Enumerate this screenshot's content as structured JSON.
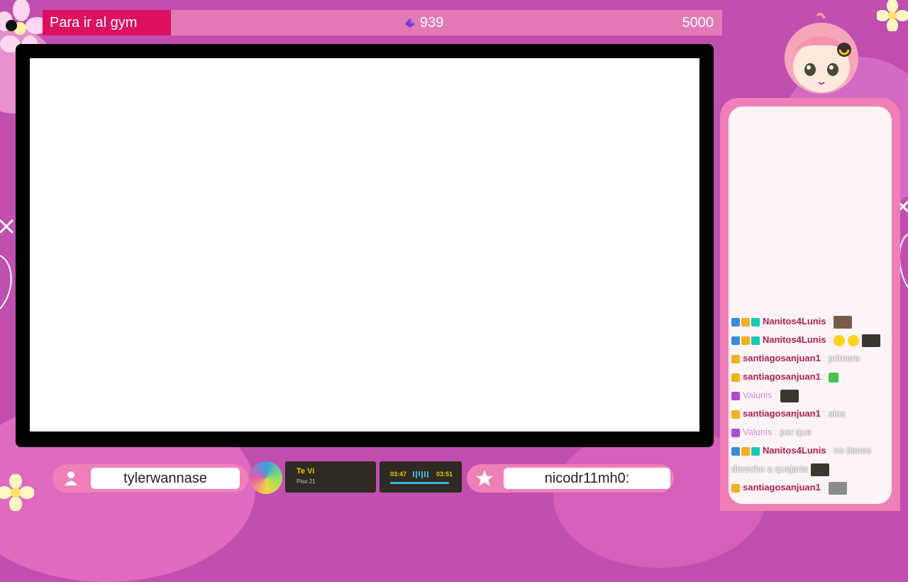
{
  "goal": {
    "title": "Para ir al gym",
    "current": "939",
    "target": "5000",
    "icon": "bits-gem-icon"
  },
  "colors": {
    "background": "#c04fb0",
    "accent_pink": "#f07fb8",
    "goal_title": "#dd1060",
    "chat_bg": "#fdf4f7",
    "username": "#b31d4a"
  },
  "chat": {
    "messages": [
      {
        "user": "Nanitos4Lunis",
        "sep": " :",
        "text": "",
        "badges": [
          "#3a8bd8",
          "#f2b21b",
          "#18c9b5"
        ],
        "emotes": [
          "brown"
        ]
      },
      {
        "user": "Nanitos4Lunis",
        "sep": " :",
        "text": "",
        "badges": [
          "#3a8bd8",
          "#f2b21b",
          "#18c9b5"
        ],
        "emotes": [
          "yellow",
          "yellow",
          "dark"
        ]
      },
      {
        "user": "santiagosanjuan1",
        "sep": " :",
        "text": "primero",
        "badges": [
          "#f2b21b"
        ],
        "emotes": []
      },
      {
        "user": "santiagosanjuan1",
        "sep": " :",
        "text": "",
        "badges": [
          "#f2b21b"
        ],
        "emotes": [
          "green"
        ]
      },
      {
        "user": "Valunis",
        "sep": " :",
        "text": "",
        "badges": [
          "#b04ad0"
        ],
        "emotes": [
          "dark"
        ],
        "purple": true
      },
      {
        "user": "santiagosanjuan1",
        "sep": " :",
        "text": "aios",
        "badges": [
          "#f2b21b"
        ],
        "emotes": []
      },
      {
        "user": "Valunis",
        "sep": " :",
        "text": "por que",
        "badges": [
          "#b04ad0"
        ],
        "emotes": [],
        "purple": true
      },
      {
        "user": "Nanitos4Lunis",
        "sep": " :",
        "text": "no tienes derecho a quejarte",
        "badges": [
          "#3a8bd8",
          "#f2b21b",
          "#18c9b5"
        ],
        "emotes": [
          "dark"
        ]
      },
      {
        "user": "santiagosanjuan1",
        "sep": " :",
        "text": "",
        "badges": [
          "#f2b21b"
        ],
        "emotes": [
          "gray"
        ]
      }
    ]
  },
  "latest_follower": {
    "name": "tylerwannase",
    "icon": "user-icon"
  },
  "latest_subscriber": {
    "name": "nicodr11mh0:",
    "icon": "star-icon"
  },
  "now_playing": {
    "title": "Te Vi",
    "artist": "Piso 21",
    "elapsed": "03:47",
    "duration": "03:51",
    "progress": 0.98
  }
}
